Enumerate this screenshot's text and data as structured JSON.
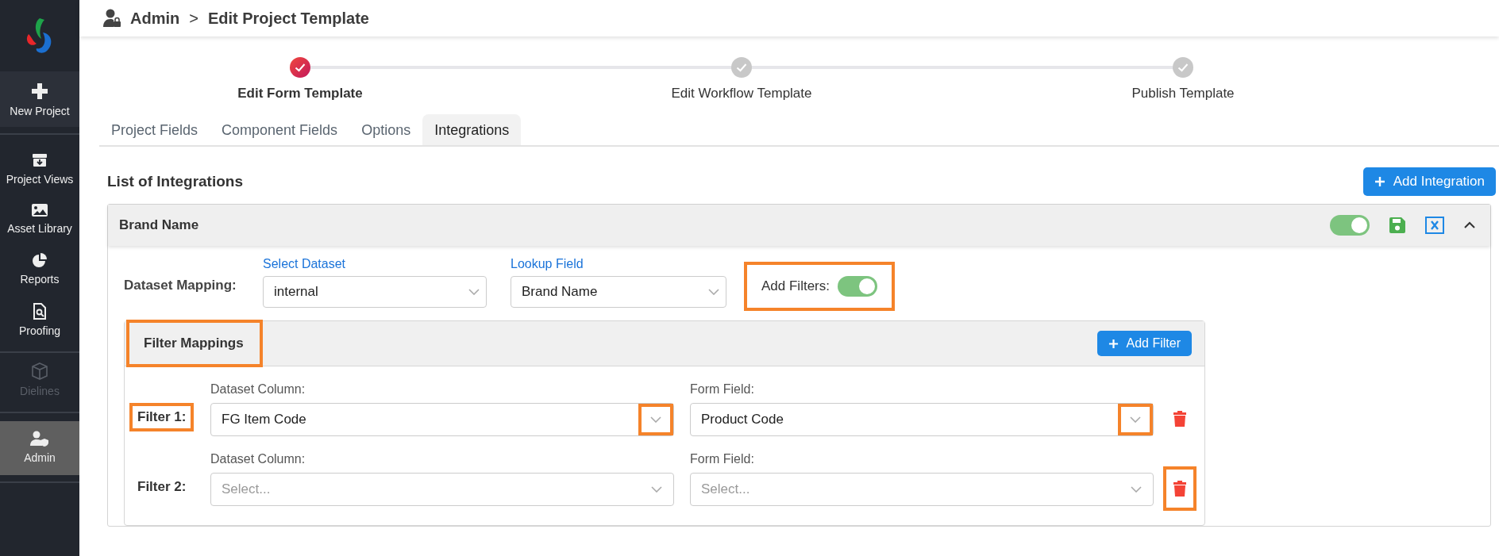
{
  "sidebar": {
    "groups": [
      [
        {
          "label": "New Project",
          "kind": "action",
          "selected": false,
          "disabled": false
        }
      ],
      [
        {
          "label": "Project Views",
          "kind": "nav",
          "selected": false,
          "disabled": false
        },
        {
          "label": "Asset Library",
          "kind": "nav",
          "selected": false,
          "disabled": false
        },
        {
          "label": "Reports",
          "kind": "nav",
          "selected": false,
          "disabled": false
        },
        {
          "label": "Proofing",
          "kind": "nav",
          "selected": false,
          "disabled": false
        }
      ],
      [
        {
          "label": "Dielines",
          "kind": "nav",
          "selected": false,
          "disabled": true
        }
      ],
      [
        {
          "label": "Admin",
          "kind": "nav",
          "selected": true,
          "disabled": false
        }
      ]
    ]
  },
  "breadcrumb": {
    "items": [
      "Admin",
      "Edit Project Template"
    ],
    "separator": ">"
  },
  "steps": [
    {
      "label": "Edit Form Template",
      "selected": true
    },
    {
      "label": "Edit Workflow Template",
      "selected": false
    },
    {
      "label": "Publish Template",
      "selected": false
    }
  ],
  "tabs": [
    {
      "label": "Project Fields",
      "selected": false
    },
    {
      "label": "Component Fields",
      "selected": false
    },
    {
      "label": "Options",
      "selected": false
    },
    {
      "label": "Integrations",
      "selected": true
    }
  ],
  "section": {
    "title": "List of Integrations",
    "add_button": "Add Integration"
  },
  "integration": {
    "title": "Brand Name",
    "enabled": true,
    "expanded": true,
    "dataset_mapping": {
      "label": "Dataset Mapping:",
      "select_dataset": {
        "label": "Select Dataset",
        "value": "internal"
      },
      "lookup_field": {
        "label": "Lookup Field",
        "value": "Brand Name"
      },
      "add_filters": {
        "label": "Add Filters:",
        "on": true,
        "highlighted": true
      }
    },
    "filter_mappings": {
      "title": "Filter Mappings",
      "highlighted": true,
      "add_button": "Add Filter",
      "filters": [
        {
          "label": "Filter 1:",
          "highlighted": true,
          "dataset_column": {
            "label": "Dataset Column:",
            "value": "FG Item Code",
            "chevron_highlighted": true
          },
          "form_field": {
            "label": "Form Field:",
            "value": "Product Code",
            "chevron_highlighted": true
          },
          "delete_highlighted": false
        },
        {
          "label": "Filter 2:",
          "highlighted": false,
          "dataset_column": {
            "label": "Dataset Column:",
            "placeholder": "Select...",
            "chevron_highlighted": false
          },
          "form_field": {
            "label": "Form Field:",
            "placeholder": "Select...",
            "chevron_highlighted": false
          },
          "delete_highlighted": true
        }
      ]
    }
  }
}
